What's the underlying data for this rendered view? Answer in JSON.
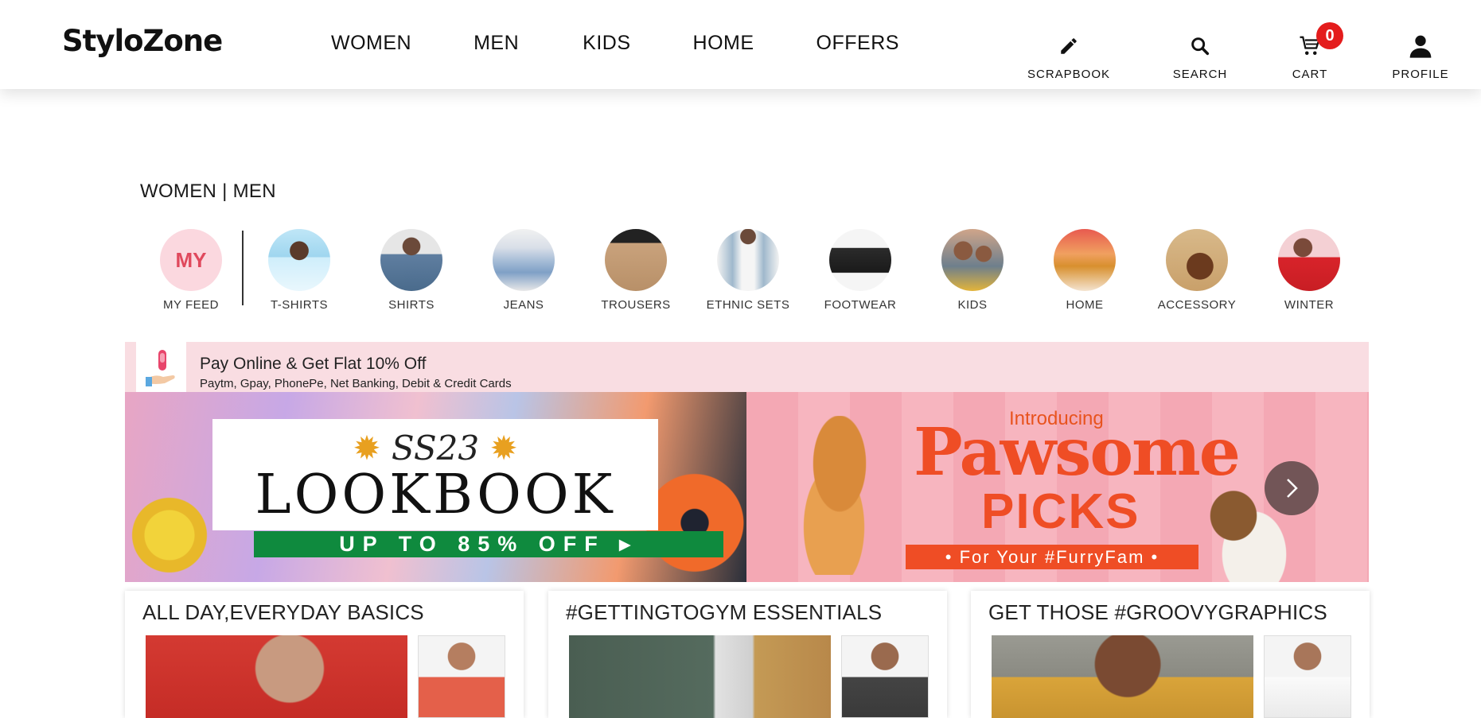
{
  "header": {
    "logo": "StyloZone",
    "nav": [
      "WOMEN",
      "MEN",
      "KIDS",
      "HOME",
      "OFFERS"
    ],
    "actions": {
      "scrapbook": "SCRAPBOOK",
      "search": "SEARCH",
      "cart": "CART",
      "cart_count": "0",
      "profile": "PROFILE"
    }
  },
  "gender_tabs": "WOMEN | MEN",
  "categories": {
    "my_feed_badge": "MY",
    "my_feed": "MY FEED",
    "items": [
      "T-SHIRTS",
      "SHIRTS",
      "JEANS",
      "TROUSERS",
      "ETHNIC SETS",
      "FOOTWEAR",
      "KIDS",
      "HOME",
      "ACCESSORY",
      "WINTER"
    ]
  },
  "offer": {
    "title": "Pay Online & Get Flat 10% Off",
    "subtitle": "Paytm, Gpay, PhonePe, Net Banking, Debit & Credit Cards"
  },
  "banners": {
    "lookbook": {
      "season": "SS23",
      "title": "LOOKBOOK",
      "discount": "UP TO 85% OFF"
    },
    "pawsome": {
      "intro": "Introducing",
      "title": "Pawsome",
      "subtitle": "PICKS",
      "tag": "• For Your #FurryFam •"
    }
  },
  "collections": [
    {
      "title": "ALL DAY,EVERYDAY BASICS"
    },
    {
      "title": "#GETTINGTOGYM ESSENTIALS"
    },
    {
      "title": "GET THOSE #GROOVYGRAPHICS"
    }
  ],
  "colors": {
    "accent_pink": "#f9dde2",
    "badge_red": "#e41c1c",
    "green": "#0f8a3e",
    "orange": "#ef4d25"
  }
}
